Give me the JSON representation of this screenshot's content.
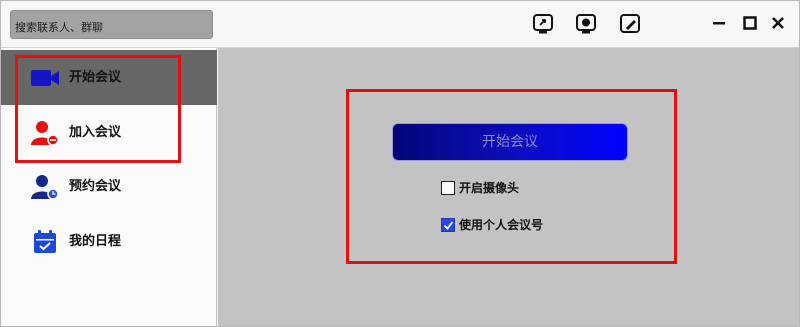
{
  "search": {
    "placeholder": "搜索联系人、群聊"
  },
  "toolbar": {
    "icons": [
      "phone-screen-icon",
      "screen-share-icon",
      "whiteboard-icon"
    ]
  },
  "window_controls": {
    "minimize_icon": "minimize-icon",
    "maximize_icon": "maximize-icon",
    "close_icon": "close-icon"
  },
  "sidebar": {
    "items": [
      {
        "label": "开始会议",
        "icon": "video-camera-icon",
        "color": "#1515c8",
        "active": true
      },
      {
        "label": "加入会议",
        "icon": "join-user-icon",
        "color": "#e61010",
        "active": false
      },
      {
        "label": "预约会议",
        "icon": "schedule-user-icon",
        "color": "#13288a",
        "active": false
      },
      {
        "label": "我的日程",
        "icon": "calendar-icon",
        "color": "#1c49dc",
        "active": false
      }
    ]
  },
  "main": {
    "start_button": "开始会议",
    "options": [
      {
        "label": "开启摄像头",
        "checked": false
      },
      {
        "label": "使用个人会议号",
        "checked": true
      }
    ]
  },
  "colors": {
    "highlight_box": "#e41010",
    "start_button_gradient": [
      "#060677",
      "#0000ff"
    ],
    "sidebar_active": "#676767",
    "main_bg": "#c3c3c3"
  }
}
